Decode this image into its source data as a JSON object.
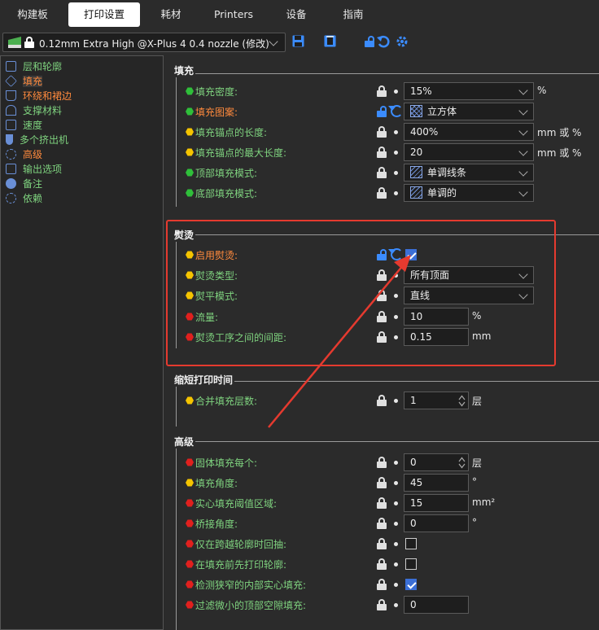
{
  "tabs": [
    {
      "label": "构建板",
      "active": false
    },
    {
      "label": "打印设置",
      "active": true
    },
    {
      "label": "耗材",
      "active": false
    },
    {
      "label": "Printers",
      "active": false
    },
    {
      "label": "设备",
      "active": false
    },
    {
      "label": "指南",
      "active": false
    }
  ],
  "preset": {
    "value": "0.12mm Extra High @X-Plus 4 0.4 nozzle (修改)"
  },
  "sidebar": {
    "items": [
      {
        "label": "层和轮廓",
        "color": "green"
      },
      {
        "label": "填充",
        "color": "orange"
      },
      {
        "label": "环绕和裙边",
        "color": "orange"
      },
      {
        "label": "支撑材料",
        "color": "green"
      },
      {
        "label": "速度",
        "color": "green"
      },
      {
        "label": "多个挤出机",
        "color": "green"
      },
      {
        "label": "高级",
        "color": "orange"
      },
      {
        "label": "输出选项",
        "color": "green"
      },
      {
        "label": "备注",
        "color": "green"
      },
      {
        "label": "依赖",
        "color": "green"
      }
    ]
  },
  "groups": {
    "infill": {
      "title": "填充"
    },
    "ironing": {
      "title": "熨烫"
    },
    "reduce": {
      "title": "缩短打印时间"
    },
    "advanced": {
      "title": "高级"
    }
  },
  "rows": {
    "infill_density": {
      "label": "填充密度:",
      "value": "15%",
      "unit": "%"
    },
    "infill_pattern": {
      "label": "填充图案:",
      "value": "立方体"
    },
    "anchor_length": {
      "label": "填充锚点的长度:",
      "value": "400%",
      "unit": "mm 或 %"
    },
    "anchor_max": {
      "label": "填充锚点的最大长度:",
      "value": "20",
      "unit": "mm 或 %"
    },
    "top_pattern": {
      "label": "顶部填充模式:",
      "value": "单调线条"
    },
    "bottom_pattern": {
      "label": "底部填充模式:",
      "value": "单调的"
    },
    "enable_ironing": {
      "label": "启用熨烫:",
      "checked": true
    },
    "ironing_type": {
      "label": "熨烫类型:",
      "value": "所有顶面"
    },
    "ironing_pattern": {
      "label": "熨平模式:",
      "value": "直线"
    },
    "flow": {
      "label": "流量:",
      "value": "10",
      "unit": "%"
    },
    "ironing_spacing": {
      "label": "熨烫工序之间的间距:",
      "value": "0.15",
      "unit": "mm"
    },
    "combine_infill": {
      "label": "合并填充层数:",
      "value": "1",
      "unit": "层"
    },
    "solid_every": {
      "label": "固体填充每个:",
      "value": "0",
      "unit": "层"
    },
    "infill_angle": {
      "label": "填充角度:",
      "value": "45",
      "unit": "°"
    },
    "solid_threshold": {
      "label": "实心填充阈值区域:",
      "value": "15",
      "unit": "mm²"
    },
    "bridge_angle": {
      "label": "桥接角度:",
      "value": "0",
      "unit": "°"
    },
    "retract_crossing": {
      "label": "仅在跨越轮廓时回抽:",
      "checked": false
    },
    "perimeters_first": {
      "label": "在填充前先打印轮廓:",
      "checked": false
    },
    "detect_narrow": {
      "label": "检测狭窄的内部实心填充:",
      "checked": true
    },
    "filter_small": {
      "label": "过滤微小的顶部空隙填充:",
      "value": "0"
    }
  },
  "colors": {
    "green_dot": "#2fbf3a",
    "yellow_dot": "#f5c400",
    "red_dot": "#e0201e",
    "accent": "#3b8cff",
    "highlight": "#e53a2f"
  }
}
